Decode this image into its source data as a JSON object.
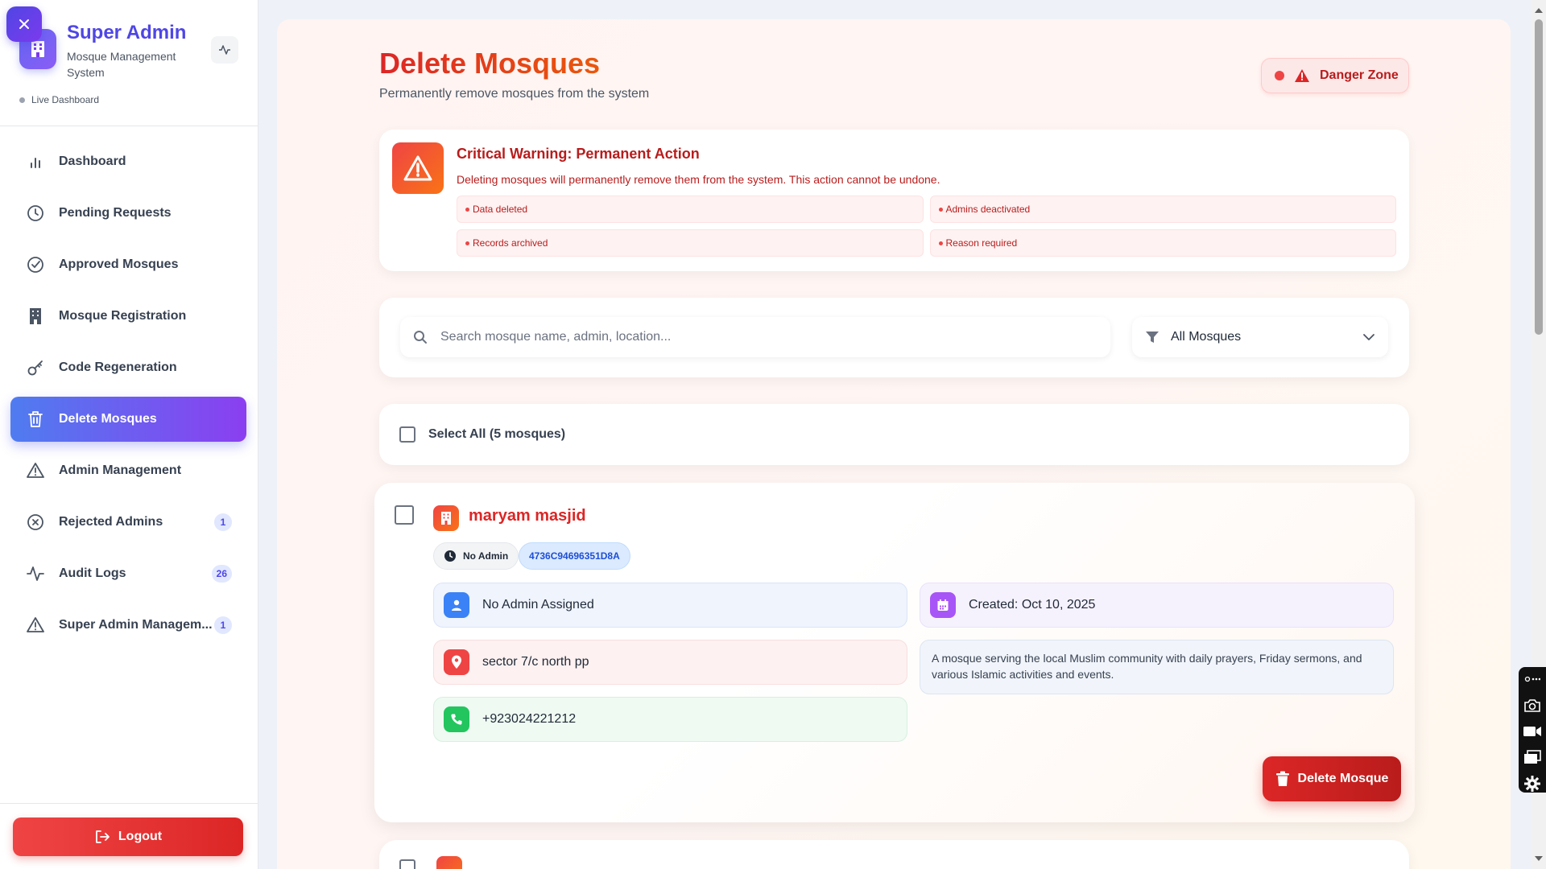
{
  "sidebar": {
    "brand_title": "Super Admin",
    "brand_subtitle": "Mosque Management System",
    "live_label": "Live Dashboard",
    "items": [
      {
        "label": "Dashboard",
        "icon": "bar-chart-icon"
      },
      {
        "label": "Pending Requests",
        "icon": "clock-icon"
      },
      {
        "label": "Approved Mosques",
        "icon": "check-circle-icon"
      },
      {
        "label": "Mosque Registration",
        "icon": "building-icon"
      },
      {
        "label": "Code Regeneration",
        "icon": "key-icon"
      },
      {
        "label": "Delete Mosques",
        "icon": "trash-icon",
        "active": true
      },
      {
        "label": "Admin Management",
        "icon": "warning-triangle-icon"
      },
      {
        "label": "Rejected Admins",
        "icon": "x-circle-icon",
        "badge": "1"
      },
      {
        "label": "Audit Logs",
        "icon": "activity-icon",
        "badge": "26"
      },
      {
        "label": "Super Admin Managem...",
        "icon": "warning-triangle-icon",
        "badge": "1"
      }
    ],
    "logout_label": "Logout"
  },
  "header": {
    "title": "Delete Mosques",
    "subtitle": "Permanently remove mosques from the system",
    "danger_zone_label": "Danger Zone"
  },
  "warning": {
    "title": "Critical Warning: Permanent Action",
    "text": "Deleting mosques will permanently remove them from the system. This action cannot be undone.",
    "chips": [
      "Data deleted",
      "Admins deactivated",
      "Records archived",
      "Reason required"
    ]
  },
  "filters": {
    "search_placeholder": "Search mosque name, admin, location...",
    "select_value": "All Mosques"
  },
  "select_all_label": "Select All (5 mosques)",
  "mosque": {
    "name": "maryam masjid",
    "status_tag": "No Admin",
    "code": "4736C94696351D8A",
    "admin": "No Admin Assigned",
    "created": "Created: Oct 10, 2025",
    "location": "sector 7/c north pp",
    "phone": "+923024221212",
    "description": "A mosque serving the local Muslim community with daily prayers, Friday sermons, and various Islamic activities and events.",
    "delete_label": "Delete Mosque"
  },
  "colors": {
    "accent": "#4f46e5",
    "danger": "#dc2626",
    "active_gradient_start": "#4f7cf0",
    "active_gradient_end": "#8b3ff0"
  }
}
